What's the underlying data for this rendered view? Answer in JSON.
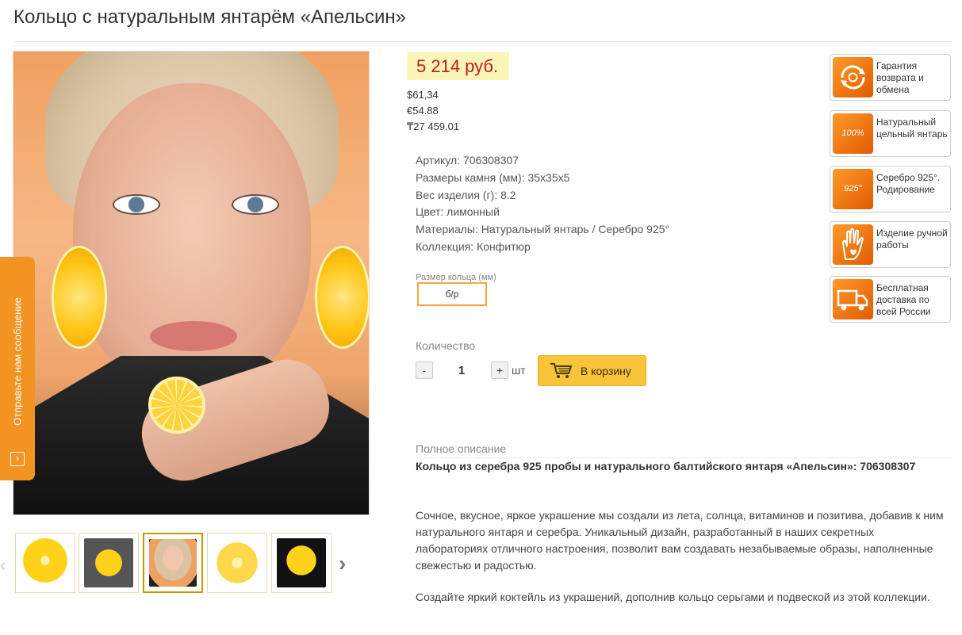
{
  "product": {
    "title": "Кольцо с натуральным янтарём «Апельсин»"
  },
  "price": {
    "main": "5 214 руб.",
    "usd": "$61,34",
    "eur": "€54.88",
    "kzt": "₸27 459.01",
    "accent_color": "#c4181b"
  },
  "properties": [
    {
      "label": "Артикул:",
      "value": "706308307"
    },
    {
      "label": "Размеры камня (мм):",
      "value": "35х35х5"
    },
    {
      "label": "Вес изделия (г):",
      "value": "8.2"
    },
    {
      "label": "Цвет:",
      "value": "лимонный"
    },
    {
      "label": "Материалы:",
      "value": "Натуральный янтарь / Серебро 925°"
    },
    {
      "label": "Коллекция:",
      "value": "Конфитюр"
    }
  ],
  "size": {
    "label": "Размер кольца (мм)",
    "selected": "б/р"
  },
  "quantity": {
    "label": "Количество",
    "minus": "-",
    "value": "1",
    "plus": "+",
    "unit": "шт"
  },
  "cart": {
    "label": "В корзину",
    "icon": "cart-icon"
  },
  "feedback": {
    "label": "Отправьте нам сообщение",
    "icon": "message-icon"
  },
  "description": {
    "label": "Полное описание",
    "heading": "Кольцо из серебра 925 пробы и натурального балтийского янтаря «Апельсин»: 706308307",
    "paragraphs": [
      "Сочное, вкусное, яркое украшение мы создали из лета, солнца, витаминов и позитива, добавив к ним натурального янтаря и серебра. Уникальный дизайн, разработанный в наших секретных лабораториях отличного настроения, позволит вам создавать незабываемые образы, наполненные свежестью и радостью.",
      "Создайте яркий коктейль из украшений, дополнив кольцо серьгами и подвеской из этой коллекции."
    ]
  },
  "badges": [
    {
      "icon": "return-exchange-icon",
      "text": "Гарантия возврата и обмена"
    },
    {
      "icon": "natural-amber-100-icon",
      "icon_text": "100%",
      "text": "Натуральный цельный янтарь"
    },
    {
      "icon": "silver-925-icon",
      "icon_text": "925°",
      "text": "Серебро 925°. Родирование"
    },
    {
      "icon": "handmade-icon",
      "text": "Изделие ручной работы"
    },
    {
      "icon": "delivery-truck-icon",
      "text": "Бесплатная доставка по всей России"
    }
  ],
  "thumbnails": {
    "prev_icon": "chevron-left-icon",
    "next_icon": "chevron-right-icon",
    "active_index": 2,
    "count": 5
  }
}
